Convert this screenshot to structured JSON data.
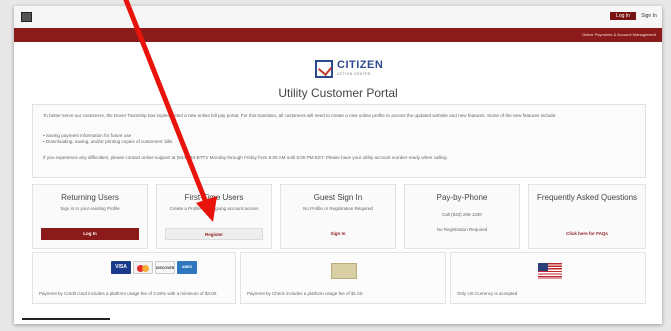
{
  "header": {
    "login_label": "Log In",
    "signin_label": "Sign In",
    "tagline": "Online Payments & Account Management"
  },
  "brand": {
    "name": "CITIZEN",
    "subtitle": "ACTION CENTER"
  },
  "page_title": "Utility Customer Portal",
  "notice": {
    "intro": "To better serve our customers, the Dover Township has implemented a new online bill pay portal. For this transition, all customers will need to create a new online profile to access the updated website and new features. Some of the new features include:",
    "bullet_1": "• Saving payment information for future use",
    "bullet_2": "• Downloading, saving, and/or printing copies of customers' bills",
    "contact": "If you experience any difficulties, please contact online support at (844)534-BTTV Monday through Friday from 8:00 AM until 5:00 PM EST. Please have your utility account number ready when calling."
  },
  "cards": [
    {
      "title": "Returning Users",
      "desc": "Sign in to your existing Profile",
      "button": "Log In"
    },
    {
      "title": "First-Time Users",
      "desc": "Create a Profile for on-going account access",
      "button": "Register"
    },
    {
      "title": "Guest Sign In",
      "desc": "No Profile or Registration Required",
      "button": "Sign In"
    },
    {
      "title": "Pay-by-Phone",
      "desc": "Call (833) 286-1230",
      "desc2": "No Registration Required",
      "button": ""
    },
    {
      "title": "Frequently Asked Questions",
      "desc": "",
      "button": "Click here for FAQs"
    }
  ],
  "payments": {
    "card_labels": {
      "visa": "VISA",
      "mastercard": "",
      "discover": "DISCOVER",
      "amex": "AMEX"
    },
    "card_text": "Payment by Credit Card includes a platform usage fee of 3.00% with a minimum of $3.00.",
    "check_text": "Payment by Check includes a platform usage fee of $1.50.",
    "currency_text": "Only US Currency is accepted"
  },
  "icons": {
    "arrow": "red-arrow-annotation",
    "check": "check-icon",
    "flag": "us-flag-icon"
  },
  "colors": {
    "brand_red": "#8b1a1a",
    "brand_blue": "#2c4a8c",
    "arrow_red": "#e8140c"
  }
}
